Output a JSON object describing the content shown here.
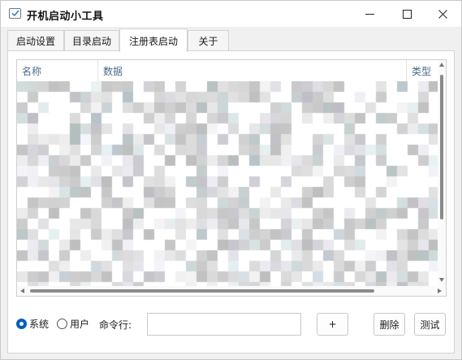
{
  "window": {
    "title": "开机启动小工具"
  },
  "tabs": [
    {
      "label": "启动设置",
      "active": false
    },
    {
      "label": "目录启动",
      "active": false
    },
    {
      "label": "注册表启动",
      "active": true
    },
    {
      "label": "关于",
      "active": false
    }
  ],
  "list": {
    "columns": [
      "名称",
      "数据",
      "类型"
    ]
  },
  "controls": {
    "radio_system": "系统",
    "radio_user": "用户",
    "radio_selected": "系统",
    "command_label": "命令行:",
    "command_value": "",
    "add_button": "+",
    "delete_button": "删除",
    "test_button": "测试"
  },
  "colors": {
    "accent": "#005fb8",
    "header_text": "#4a6a8a"
  }
}
